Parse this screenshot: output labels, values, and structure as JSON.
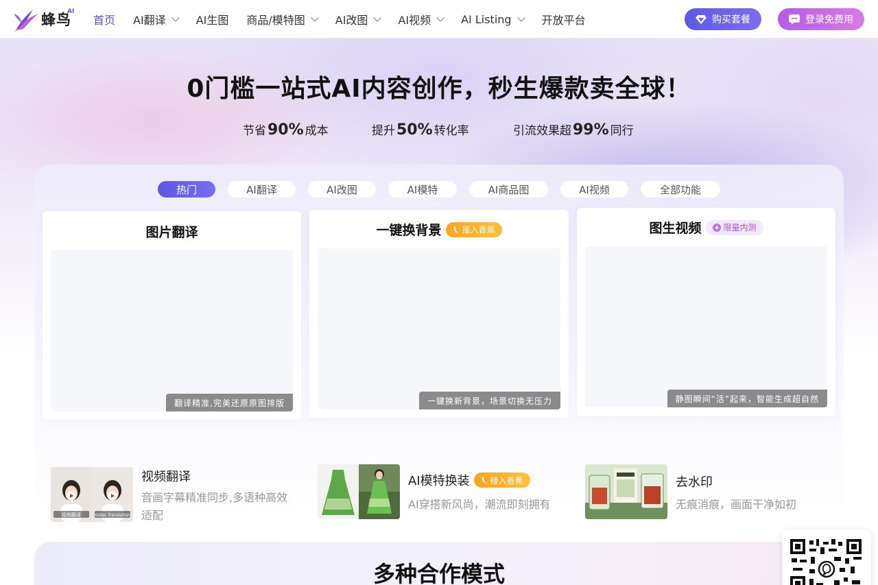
{
  "brand": {
    "name": "蜂鸟",
    "ai_tag": "AI",
    "primary": "#5b4fd6",
    "login_gradient": "#c56be6"
  },
  "nav": {
    "items": [
      {
        "label": "首页",
        "active": true,
        "dropdown": false
      },
      {
        "label": "AI翻译",
        "active": false,
        "dropdown": true
      },
      {
        "label": "AI生图",
        "active": false,
        "dropdown": false
      },
      {
        "label": "商品/模特图",
        "active": false,
        "dropdown": true
      },
      {
        "label": "AI改图",
        "active": false,
        "dropdown": true
      },
      {
        "label": "AI视频",
        "active": false,
        "dropdown": true
      },
      {
        "label": "AI Listing",
        "active": false,
        "dropdown": true
      },
      {
        "label": "开放平台",
        "active": false,
        "dropdown": false
      }
    ],
    "buy_label": "购买套餐",
    "login_label": "登录免费用"
  },
  "hero": {
    "title": "0门槛一站式AI内容创作，秒生爆款卖全球！",
    "stats": [
      {
        "prefix": "节省",
        "value": "90%",
        "suffix": "成本"
      },
      {
        "prefix": "提升",
        "value": "50%",
        "suffix": "转化率"
      },
      {
        "prefix": "引流效果超",
        "value": "99%",
        "suffix": "同行"
      }
    ]
  },
  "tabs": [
    {
      "label": "热门",
      "active": true
    },
    {
      "label": "AI翻译",
      "active": false
    },
    {
      "label": "AI改图",
      "active": false
    },
    {
      "label": "AI模特",
      "active": false
    },
    {
      "label": "AI商品图",
      "active": false
    },
    {
      "label": "AI视频",
      "active": false
    },
    {
      "label": "全部功能",
      "active": false
    }
  ],
  "cards": [
    {
      "title": "图片翻译",
      "badge": "",
      "caption": "翻译精准,完美还原原图排版"
    },
    {
      "title": "一键换背景",
      "badge": "接入香蕉",
      "caption": "一键换新背景，场景切换无压力"
    },
    {
      "title": "图生视频",
      "badge": "限量内测",
      "caption": "静图瞬间“活”起来，智能生成超自然"
    }
  ],
  "minis": [
    {
      "title": "视频翻译",
      "badge": "",
      "desc": "音画字幕精准同步,多语种高效适配",
      "thumb_labels": [
        "视频翻译",
        "Video Translation"
      ]
    },
    {
      "title": "AI模特换装",
      "badge": "接入香蕉",
      "desc": "AI穿搭新风尚，潮流即刻拥有"
    },
    {
      "title": "去水印",
      "badge": "",
      "desc": "无痕消痕，画面干净如初"
    }
  ],
  "coop": {
    "title": "多种合作模式"
  }
}
